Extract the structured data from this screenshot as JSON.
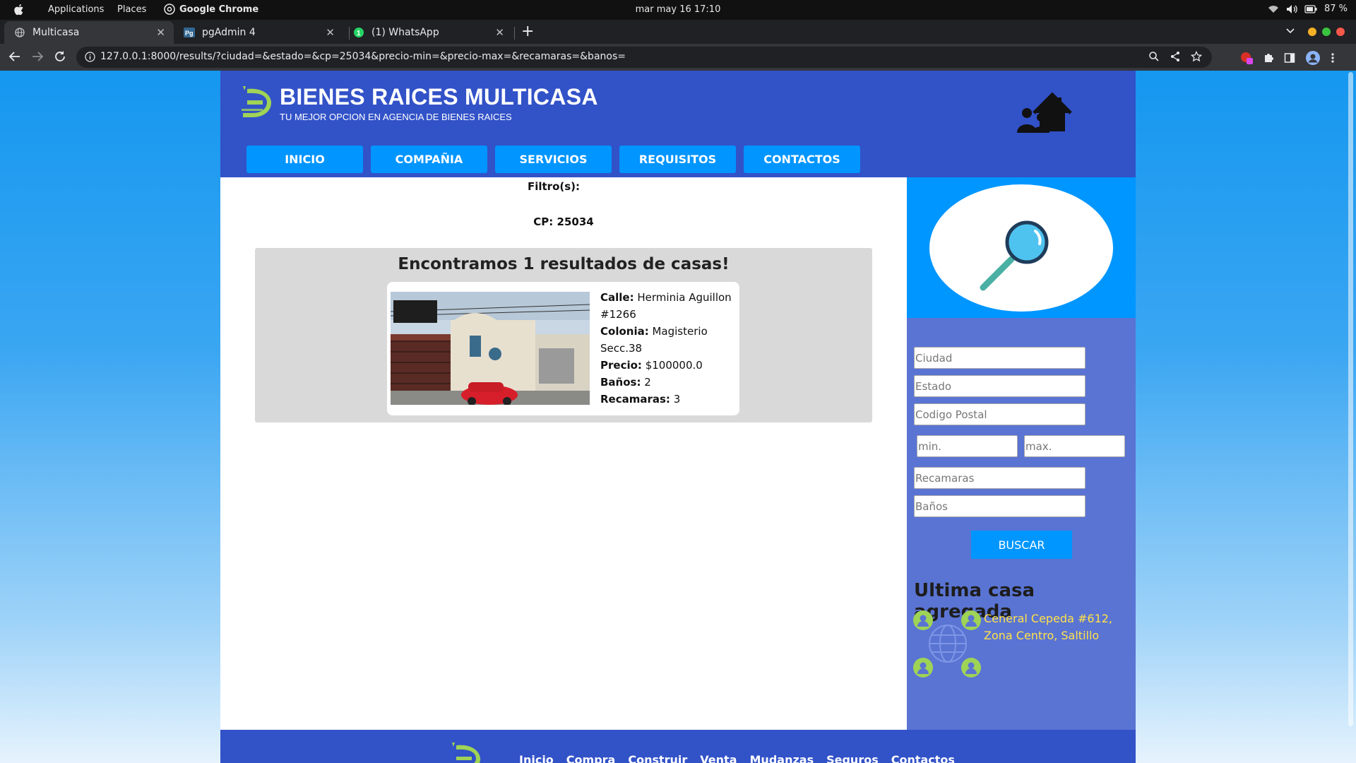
{
  "os": {
    "menu": [
      "Applications",
      "Places",
      "Google Chrome"
    ],
    "clock": "mar may 16  17:10",
    "battery": "87 %"
  },
  "browser": {
    "tabs": [
      {
        "title": "Multicasa",
        "icon": "globe-icon",
        "active": true
      },
      {
        "title": "pgAdmin 4",
        "icon": "pgadmin-icon",
        "active": false
      },
      {
        "title": "(1) WhatsApp",
        "icon": "whatsapp-icon",
        "active": false
      }
    ],
    "url": "127.0.0.1:8000/results/?ciudad=&estado=&cp=25034&precio-min=&precio-max=&recamaras=&banos="
  },
  "site": {
    "brand": "BIENES RAICES MULTICASA",
    "tagline": "TU MEJOR OPCION EN AGENCIA DE BIENES RAICES",
    "nav": [
      "INICIO",
      "COMPAÑIA",
      "SERVICIOS",
      "REQUISITOS",
      "CONTACTOS"
    ],
    "colors": {
      "header": "#3252c8",
      "nav_button": "#0095ff",
      "sidebar": "#5a74d3",
      "link": "#ffe24a"
    }
  },
  "results": {
    "filters_title": "Filtro(s):",
    "filter_cp": "CP: 25034",
    "heading": "Encontramos 1 resultados de casas!",
    "card": {
      "calle_label": "Calle:",
      "calle": "Herminia Aguillon #1266",
      "colonia_label": "Colonia:",
      "colonia": "Magisterio Secc.38",
      "precio_label": "Precio:",
      "precio": "$100000.0",
      "banos_label": "Baños:",
      "banos": "2",
      "recamaras_label": "Recamaras:",
      "recamaras": "3"
    }
  },
  "sidebar": {
    "search_icon": "magnifier-icon",
    "fields": {
      "ciudad": "Ciudad",
      "estado": "Estado",
      "cp": "Codigo Postal",
      "min": "min.",
      "max": "max.",
      "recamaras": "Recamaras",
      "banos": "Baños"
    },
    "button": "BUSCAR",
    "latest_title": "Ultima casa agregada",
    "latest_link": "Ceneral Cepeda #612, Zona Centro, Saltillo"
  },
  "footer": {
    "links": [
      "Inicio",
      "Compra",
      "Construir",
      "Venta",
      "Mudanzas",
      "Seguros",
      "Contactos"
    ]
  }
}
